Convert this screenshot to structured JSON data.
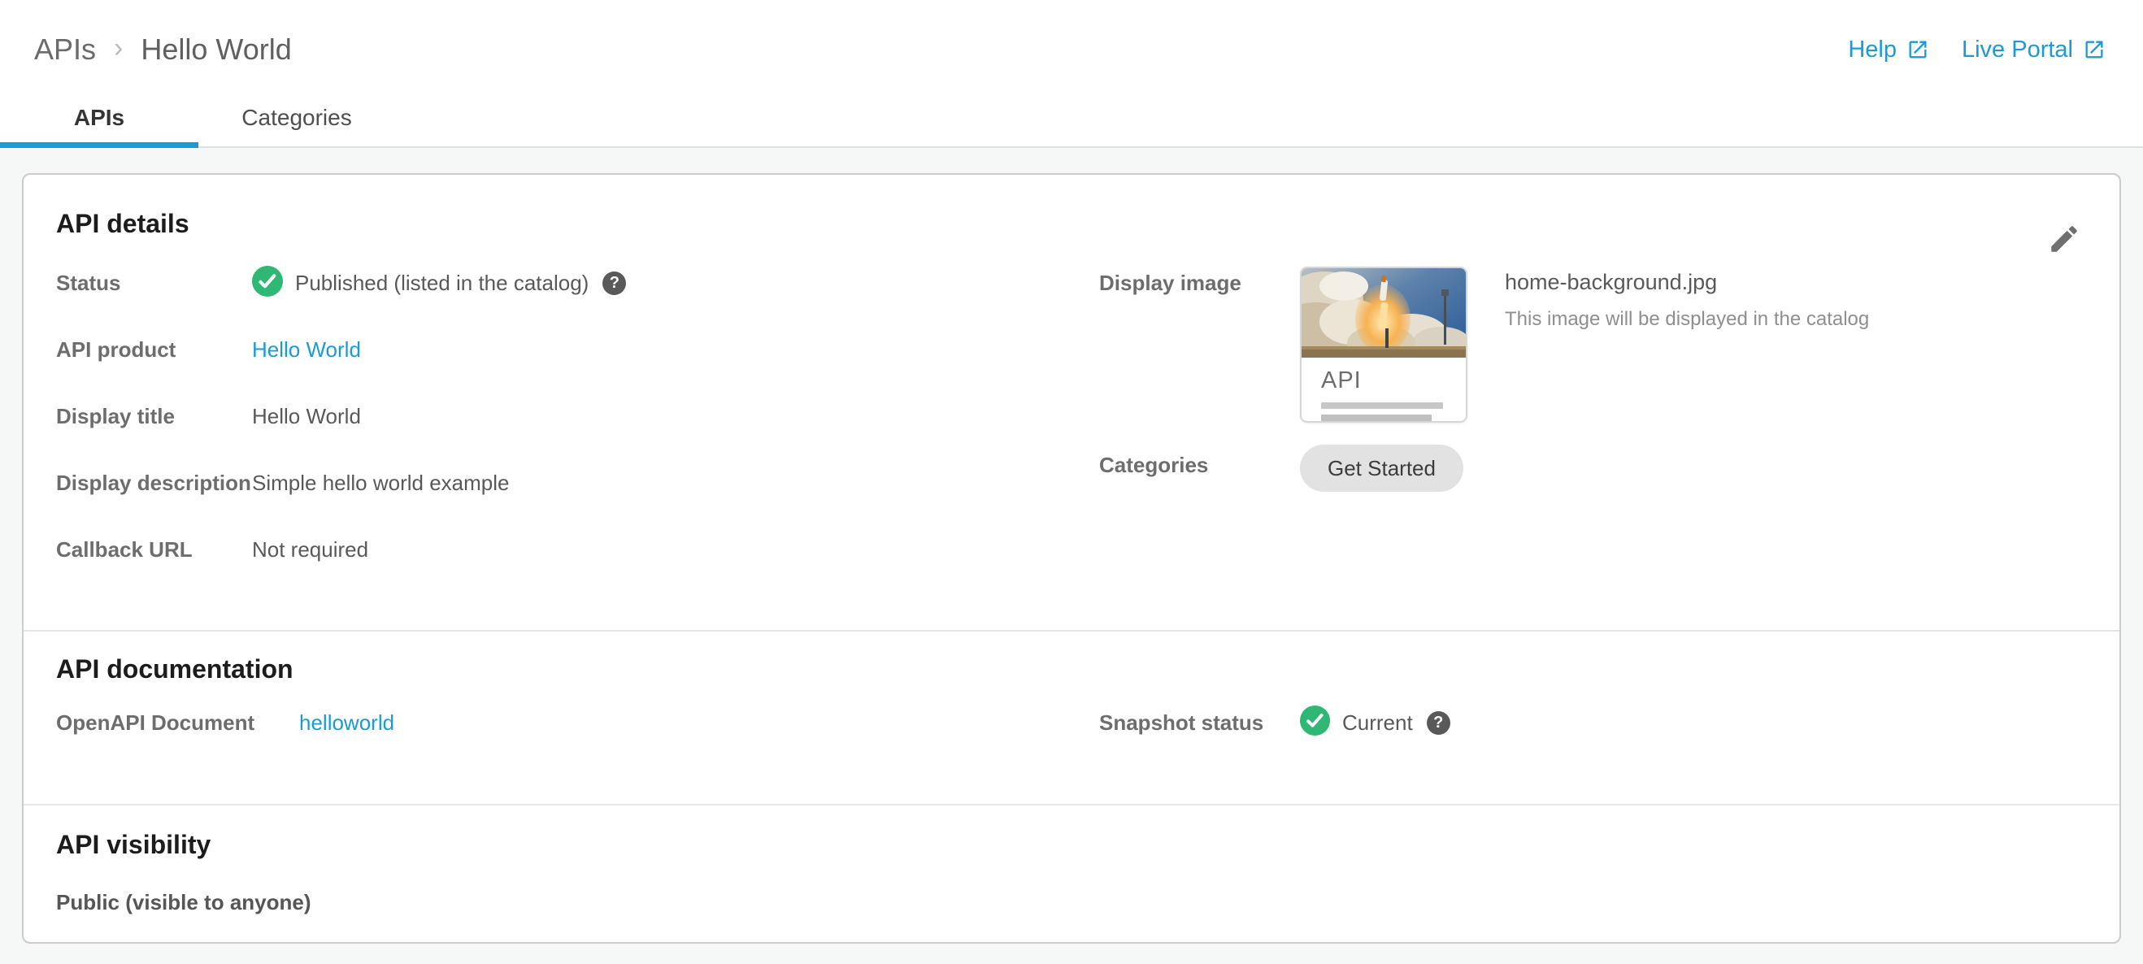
{
  "colors": {
    "accent_blue": "#1b9bd6",
    "link_blue": "#189cd8",
    "success_green": "#2eb873",
    "page_background": "#f6f7f7",
    "chip_background": "#e2e2e2"
  },
  "header": {
    "breadcrumb": {
      "parent": "APIs",
      "separator": "›",
      "current": "Hello World"
    },
    "links": {
      "help": "Help",
      "live_portal": "Live Portal"
    }
  },
  "tabs": {
    "apis": "APIs",
    "categories": "Categories",
    "active_tab": "APIs"
  },
  "details": {
    "title": "API details",
    "rows": {
      "status": {
        "label": "Status",
        "value": "Published (listed in the catalog)"
      },
      "api_product": {
        "label": "API product",
        "value": "Hello World"
      },
      "display_title": {
        "label": "Display title",
        "value": "Hello World"
      },
      "display_description": {
        "label": "Display description",
        "value": "Simple hello world example"
      },
      "callback_url": {
        "label": "Callback URL",
        "value": "Not required"
      }
    },
    "display_image": {
      "label": "Display image",
      "thumb_caption": "API",
      "filename": "home-background.jpg",
      "note": "This image will be displayed in the catalog"
    },
    "categories": {
      "label": "Categories",
      "chip": "Get Started"
    }
  },
  "documentation": {
    "title": "API documentation",
    "openapi": {
      "label": "OpenAPI Document",
      "value": "helloworld"
    },
    "snapshot": {
      "label": "Snapshot status",
      "value": "Current"
    }
  },
  "visibility": {
    "title": "API visibility",
    "value": "Public (visible to anyone)"
  }
}
